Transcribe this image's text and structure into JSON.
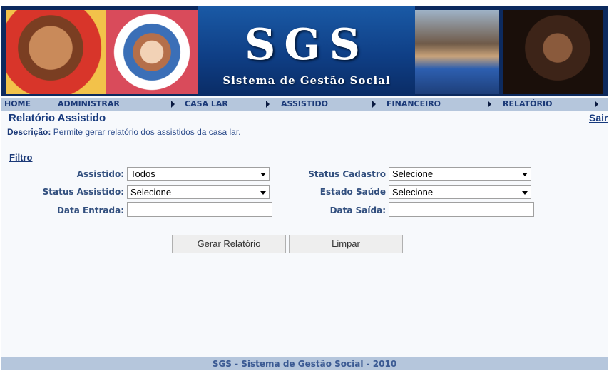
{
  "banner": {
    "logo": "SGS",
    "subtitle": "Sistema de Gestão Social"
  },
  "nav": {
    "items": [
      "HOME",
      "ADMINISTRAR",
      "CASA LAR",
      "ASSISTIDO",
      "FINANCEIRO",
      "RELATÓRIO"
    ]
  },
  "header": {
    "title": "Relatório Assistido",
    "logout": "Sair",
    "desc_label": "Descrição:",
    "desc_text": " Permite gerar relatório dos assistidos da casa lar."
  },
  "filter": {
    "title": "Filtro",
    "assistido_label": "Assistido:",
    "assistido_value": "Todos",
    "status_assistido_label": "Status Assistido:",
    "status_assistido_value": "Selecione",
    "data_entrada_label": "Data Entrada:",
    "data_entrada_value": "",
    "status_cadastro_label": "Status Cadastro",
    "status_cadastro_value": "Selecione",
    "estado_saude_label": "Estado Saúde",
    "estado_saude_value": "Selecione",
    "data_saida_label": "Data Saída:",
    "data_saida_value": ""
  },
  "actions": {
    "generate": "Gerar Relatório",
    "clear": "Limpar"
  },
  "footer": {
    "text": "SGS - Sistema de Gestão Social - 2010"
  }
}
